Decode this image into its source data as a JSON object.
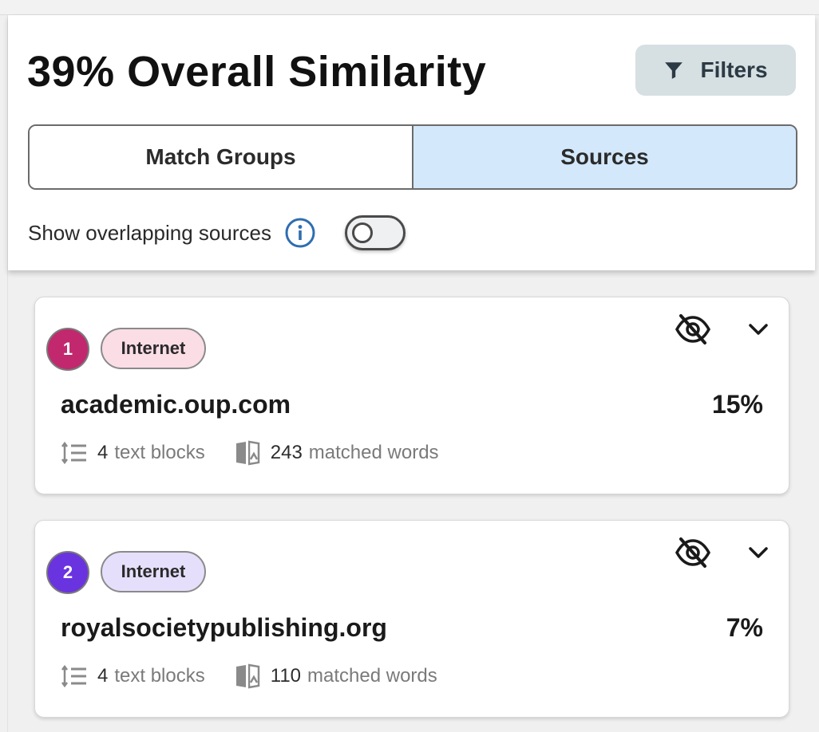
{
  "header": {
    "title": "39% Overall Similarity",
    "filters_label": "Filters"
  },
  "tabs": [
    {
      "label": "Match Groups",
      "selected": false
    },
    {
      "label": "Sources",
      "selected": true
    }
  ],
  "overlap": {
    "label": "Show overlapping sources",
    "toggle_on": false
  },
  "sources": [
    {
      "number": "1",
      "type": "Internet",
      "name": "academic.oup.com",
      "percent": "15%",
      "text_blocks_count": "4",
      "text_blocks_label": "text blocks",
      "matched_words_count": "243",
      "matched_words_label": "matched words",
      "badge_color": "#c2286d",
      "pill_color": "#fbdde6"
    },
    {
      "number": "2",
      "type": "Internet",
      "name": "royalsocietypublishing.org",
      "percent": "7%",
      "text_blocks_count": "4",
      "text_blocks_label": "text blocks",
      "matched_words_count": "110",
      "matched_words_label": "matched words",
      "badge_color": "#6a33e0",
      "pill_color": "#e6dffb"
    }
  ],
  "colors": {
    "tab_selected_bg": "#d3e8fb",
    "filters_bg": "#d6dfe2",
    "info_icon": "#2f6db0"
  }
}
